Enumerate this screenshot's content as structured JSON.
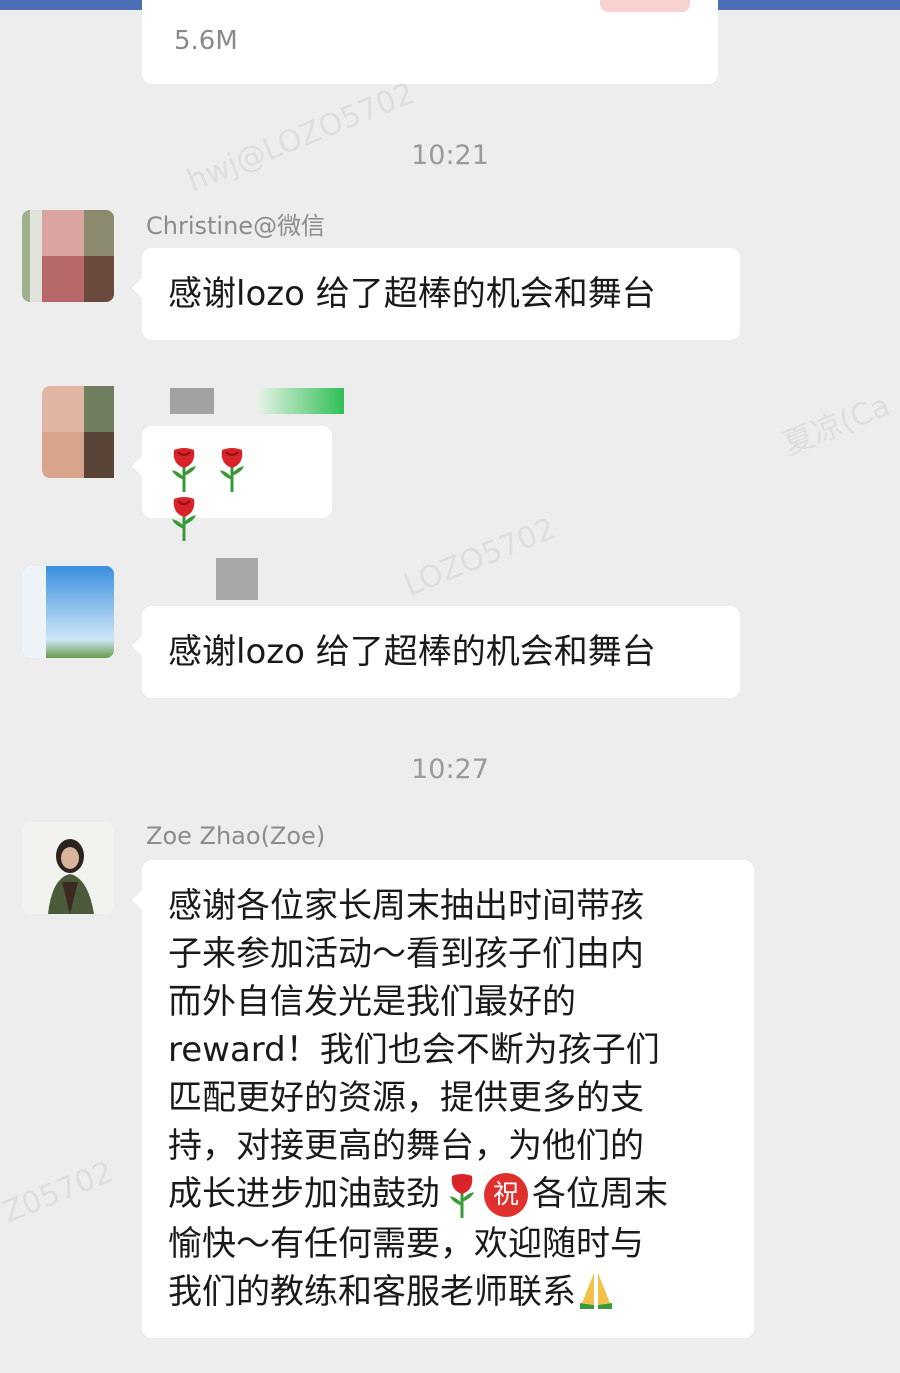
{
  "file_card": {
    "size": "5.6M"
  },
  "timestamps": [
    "10:21",
    "10:27"
  ],
  "messages": [
    {
      "sender": "Christine@微信",
      "text": "感谢lozo 给了超棒的机会和舞台"
    },
    {
      "sender": "",
      "text": ""
    },
    {
      "sender": "",
      "text": "感谢lozo 给了超棒的机会和舞台"
    },
    {
      "sender": "Zoe Zhao(Zoe)",
      "lines": [
        "感谢各位家长周末抽出时间带孩",
        "子来参加活动～看到孩子们由内",
        "而外自信发光是我们最好的",
        "reward！我们也会不断为孩子们",
        "匹配更好的资源，提供更多的支",
        "持，对接更高的舞台，为他们的",
        "成长进步加油鼓劲",
        "各位周末",
        "愉快～有任何需要，欢迎随时与",
        "我们的教练和客服老师联系"
      ],
      "badge": "祝"
    }
  ],
  "icons": [
    "rose-icon",
    "congrats-badge-icon",
    "pray-icon"
  ],
  "watermarks": [
    "hwj@LOZO5702",
    "LOZO5702",
    "Z05702",
    "夏凉(Ca"
  ],
  "colors": {
    "background": "#ededed",
    "bubble": "#ffffff",
    "text": "#1a1a1a",
    "timestamp": "#9a9a9a",
    "accent_red": "#e0302d"
  }
}
